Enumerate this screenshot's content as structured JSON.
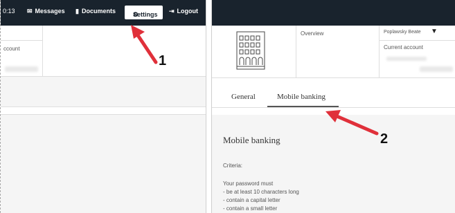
{
  "left_panel": {
    "time": "0:13",
    "nav": {
      "messages": "Messages",
      "documents": "Documents",
      "settings": "Settings",
      "logout": "Logout"
    },
    "account_partial": "ccount"
  },
  "right_panel": {
    "overview_label": "Overview",
    "user_name": "Poplawsky Beate",
    "current_account_label": "Current account",
    "tabs": {
      "general": "General",
      "mobile_banking": "Mobile banking"
    },
    "section_title": "Mobile banking",
    "criteria_label": "Criteria:",
    "password_intro": "Your password must",
    "rules": [
      "- be at least 10 characters long",
      "- contain a capital letter",
      "- contain a small letter"
    ]
  },
  "annotations": {
    "step1": "1",
    "step2": "2"
  },
  "colors": {
    "topbar": "#19232d",
    "arrow": "#e0303a",
    "tab_underline": "#555555"
  }
}
